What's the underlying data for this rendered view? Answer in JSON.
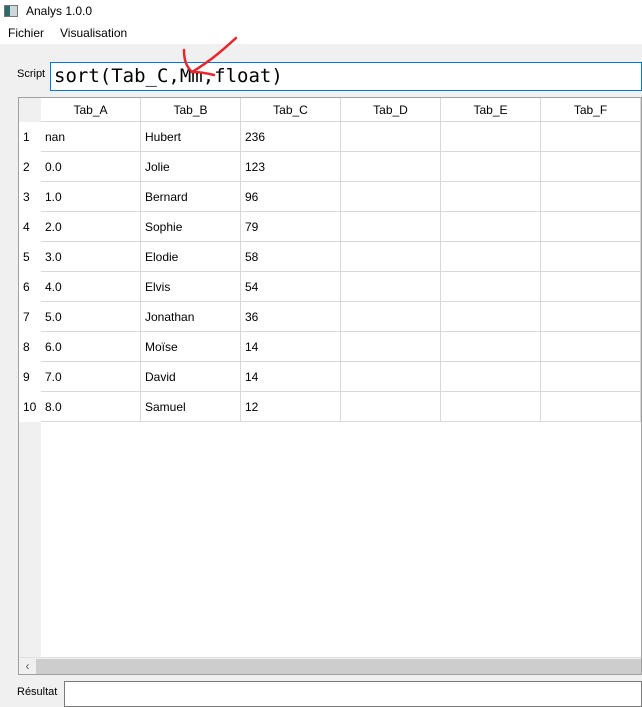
{
  "window": {
    "title": "Analys 1.0.0"
  },
  "menu": [
    "Fichier",
    "Visualisation"
  ],
  "script": {
    "label": "Script",
    "value": "sort(Tab_C,Mm,float)"
  },
  "table": {
    "columns": [
      "Tab_A",
      "Tab_B",
      "Tab_C",
      "Tab_D",
      "Tab_E",
      "Tab_F"
    ],
    "rows": [
      [
        "1",
        "nan",
        "Hubert",
        "236"
      ],
      [
        "2",
        "0.0",
        "Jolie",
        "123"
      ],
      [
        "3",
        "1.0",
        "Bernard",
        "96"
      ],
      [
        "4",
        "2.0",
        "Sophie",
        "79"
      ],
      [
        "5",
        "3.0",
        "Elodie",
        "58"
      ],
      [
        "6",
        "4.0",
        "Elvis",
        "54"
      ],
      [
        "7",
        "5.0",
        "Jonathan",
        "36"
      ],
      [
        "8",
        "6.0",
        "Moïse",
        "14"
      ],
      [
        "9",
        "7.0",
        "David",
        "14"
      ],
      [
        "10",
        "8.0",
        "Samuel",
        "12"
      ]
    ]
  },
  "scrollbar": {
    "left_arrow": "‹"
  },
  "result": {
    "label": "Résultat",
    "value": ""
  },
  "annotation": {
    "color": "#e8262c",
    "icon": "red-arrow-annotation"
  }
}
